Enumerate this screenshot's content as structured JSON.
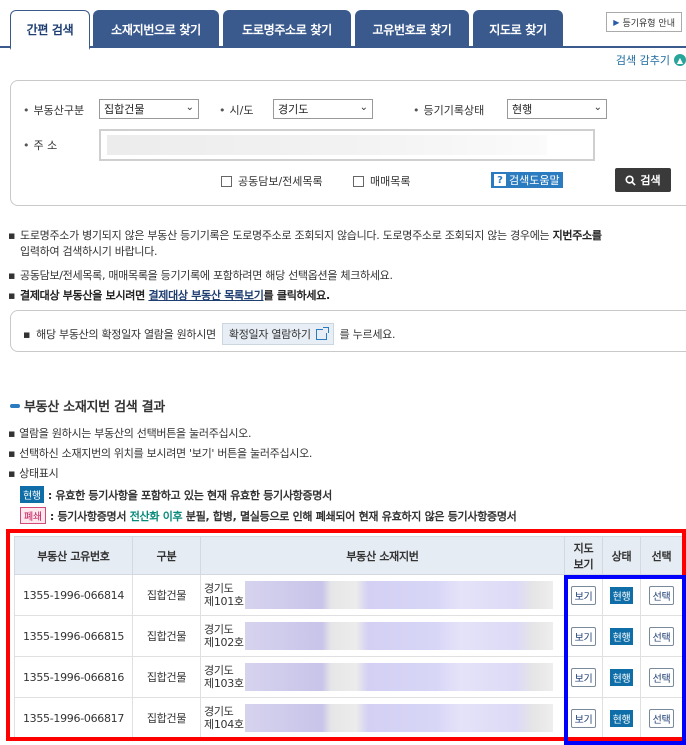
{
  "tabs": [
    {
      "label": "간편 검색",
      "active": true
    },
    {
      "label": "소재지번으로 찾기",
      "active": false
    },
    {
      "label": "도로명주소로 찾기",
      "active": false
    },
    {
      "label": "고유번호로 찾기",
      "active": false
    },
    {
      "label": "지도로 찾기",
      "active": false
    }
  ],
  "guide_button": "등기유형 안내",
  "hide_search_label": "검색 감추기",
  "search": {
    "property_type_label": "부동산구분",
    "property_type_value": "집합건물",
    "region_label": "시/도",
    "region_value": "경기도",
    "status_label": "등기기록상태",
    "status_value": "현행",
    "address_label": "주 소",
    "joint_collateral_label": "공동담보/전세목록",
    "sale_list_label": "매매목록",
    "help_button": "검색도움말",
    "search_button": "검색"
  },
  "notices": {
    "line1_a": "도로명주소가 병기되지 않은 부동산 등기기록은 도로명주소로 조회되지 않습니다. 도로명주소로 조회되지 않는 경우에는 ",
    "line1_b": "지번주소를",
    "line1_c": "입력하여 검색하시기 바랍니다.",
    "line2": "공동담보/전세목록, 매매목록을 등기기록에 포함하려면 해당 선택옵션을 체크하세요.",
    "line3_a": "결제대상 부동산을 보시려면 ",
    "line3_link": "결제대상 부동산 목록보기",
    "line3_b": "를 클릭하세요.",
    "confirm_a": "해당 부동산의 확정일자 열람을 원하시면",
    "confirm_button": "확정일자 열람하기",
    "confirm_b": "를 누르세요."
  },
  "results": {
    "title": "부동산 소재지번 검색 결과",
    "note1": "열람을 원하시는 부동산의 선택버튼을 눌러주십시오.",
    "note2": "선택하신 소재지번의 위치를 보시려면 '보기' 버튼을 눌러주십시오.",
    "note3": "상태표시",
    "legend_active_tag": "현행",
    "legend_active_text": ": 유효한 등기사항을 포함하고 있는 현재 유효한 등기사항증명서",
    "legend_closed_tag": "폐쇄",
    "legend_closed_a": ": 등기사항증명서 ",
    "legend_closed_teal": "전산화 이후",
    "legend_closed_b": " 분필, 합병, 멸실등으로 인해 폐쇄되어 현재 유효하지 않은 등기사항증명서",
    "columns": {
      "id": "부동산 고유번호",
      "type": "구분",
      "address": "부동산 소재지번",
      "map_l1": "지도",
      "map_l2": "보기",
      "state": "상태",
      "select": "선택"
    },
    "rows": [
      {
        "id": "1355-1996-066814",
        "type": "집합건물",
        "addr1": "경기도",
        "addr2": "제101호",
        "map": "보기",
        "state": "현행",
        "select": "선택"
      },
      {
        "id": "1355-1996-066815",
        "type": "집합건물",
        "addr1": "경기도",
        "addr2": "제102호",
        "map": "보기",
        "state": "현행",
        "select": "선택"
      },
      {
        "id": "1355-1996-066816",
        "type": "집합건물",
        "addr1": "경기도",
        "addr2": "제103호",
        "map": "보기",
        "state": "현행",
        "select": "선택"
      },
      {
        "id": "1355-1996-066817",
        "type": "집합건물",
        "addr1": "경기도",
        "addr2": "제104호",
        "map": "보기",
        "state": "현행",
        "select": "선택"
      }
    ]
  },
  "colors": {
    "tab_bg": "#3a5a8e",
    "accent_blue": "#2b7bc0",
    "status_active": "#0f6ea8",
    "highlight_red": "#ff0000",
    "highlight_blue": "#0000ff"
  }
}
